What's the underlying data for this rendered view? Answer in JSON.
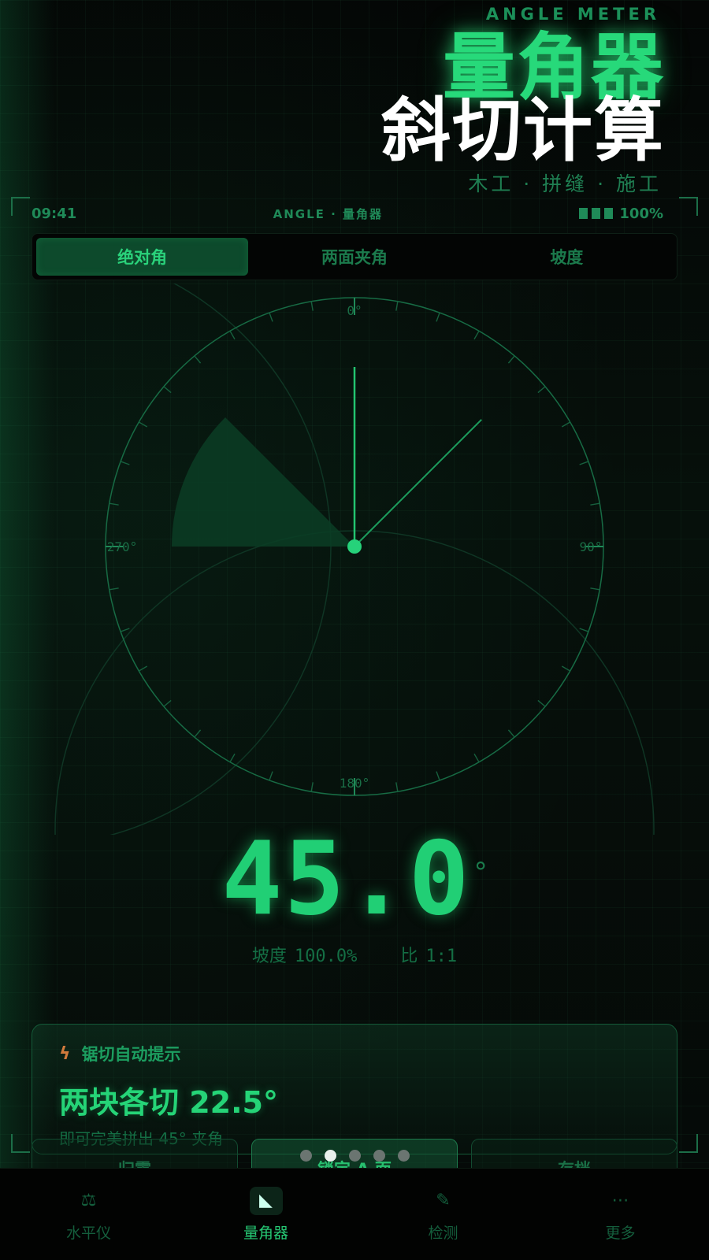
{
  "hero": {
    "subtitle_en": "ANGLE METER",
    "title_line1": "量角器",
    "title_line2": "斜切计算",
    "tagline": "木工 · 拼缝 · 施工"
  },
  "status": {
    "time": "09:41",
    "center": "ANGLE · 量角器",
    "battery": "100%"
  },
  "modes": [
    {
      "label": "绝对角",
      "active": true
    },
    {
      "label": "两面夹角",
      "active": false
    },
    {
      "label": "坡度",
      "active": false
    }
  ],
  "dial": {
    "labels": {
      "top": "0°",
      "right": "90°",
      "bottom": "180°",
      "left": "270°"
    },
    "needle_angle_deg": 45,
    "wedge_start_deg": 270,
    "wedge_end_deg": 315
  },
  "readout": {
    "value": "45.0",
    "unit": "°",
    "slope_label": "坡度",
    "slope_value": "100.0%",
    "ratio_label": "比",
    "ratio_value": "1:1"
  },
  "hint": {
    "title": "锯切自动提示",
    "main": "两块各切 22.5°",
    "note": "即可完美拼出 45° 夹角"
  },
  "actions": [
    {
      "label": "归零"
    },
    {
      "label": "锁定 A 面"
    },
    {
      "label": "存档"
    }
  ],
  "pager": {
    "count": 5,
    "active": 1
  },
  "tabs": [
    {
      "label": "水平仪",
      "icon": "level-icon",
      "glyph": "⚖",
      "active": false
    },
    {
      "label": "量角器",
      "icon": "protractor-icon",
      "glyph": "◣",
      "active": true
    },
    {
      "label": "检测",
      "icon": "inspect-icon",
      "glyph": "✎",
      "active": false
    },
    {
      "label": "更多",
      "icon": "more-icon",
      "glyph": "⋯",
      "active": false
    }
  ],
  "colors": {
    "accent": "#27d97a",
    "accent_dim": "#1a7c4c",
    "background": "#050807"
  }
}
